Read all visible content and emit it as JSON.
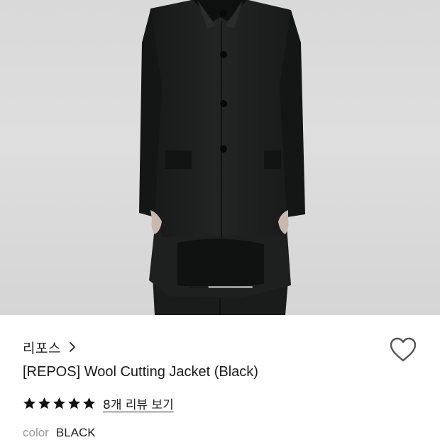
{
  "product": {
    "brand": "리포스",
    "title": "[REPOS] Wool Cutting Jacket (Black)",
    "rating": {
      "stars": 5,
      "max": 5,
      "review_link": "8개 리뷰 보기"
    },
    "color": {
      "label": "color",
      "value": "BLACK"
    }
  },
  "gallery": {
    "current_fraction": 0.33
  },
  "icons": {
    "brand_chevron": "chevron-right-icon",
    "wishlist": "heart-outline-icon",
    "star": "star-icon"
  },
  "colors": {
    "star_fill": "#111111",
    "accent_text": "#222222",
    "muted_text": "#999999",
    "jacket": "#1c1d1d"
  }
}
